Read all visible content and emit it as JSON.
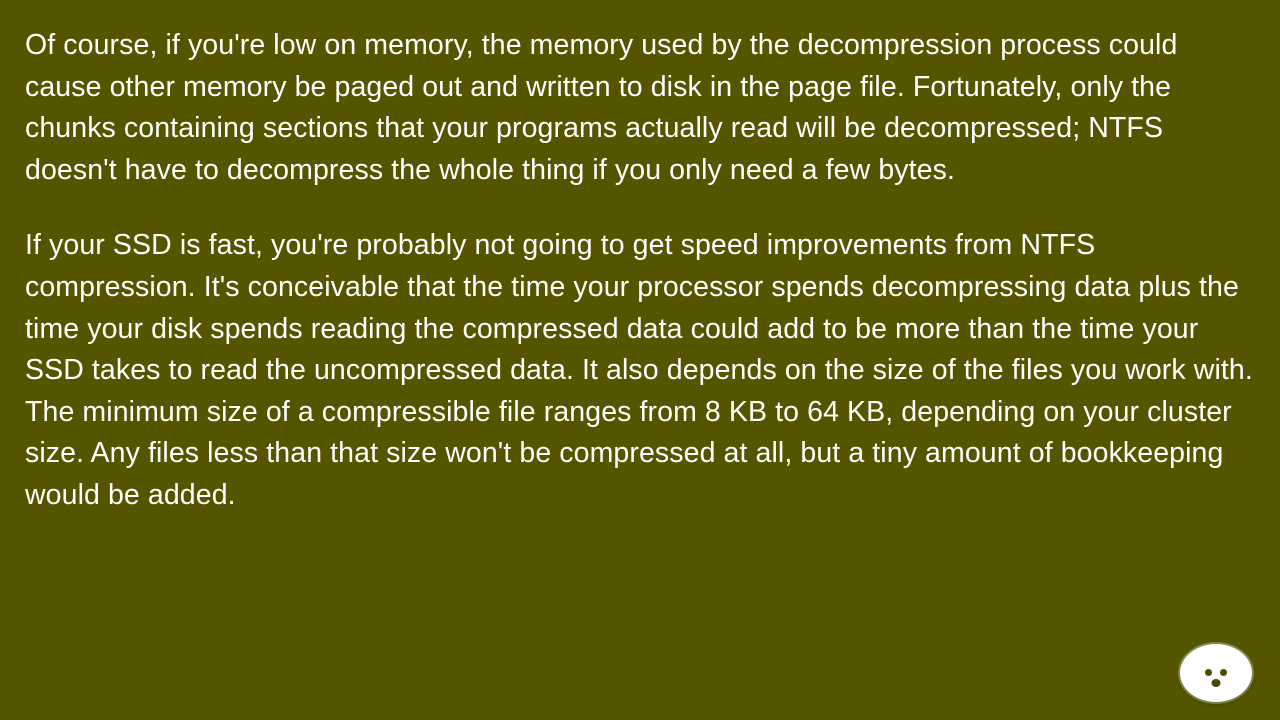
{
  "content": {
    "paragraphs": [
      "Of course, if you're low on memory, the memory used by the decompression process could cause other memory be paged out and written to disk in the page file. Fortunately, only the chunks containing sections that your programs actually read will be decompressed; NTFS doesn't have to decompress the whole thing if you only need a few bytes.",
      "If your SSD is fast, you're probably not going to get speed improvements from NTFS compression. It's conceivable that the time your processor spends decompressing data plus the time your disk spends reading the compressed data could add to be more than the time your SSD takes to read the uncompressed data. It also depends on the size of the files you work with. The minimum size of a compressible file ranges from 8 KB to 64 KB, depending on your cluster size. Any files less than that size won't be compressed at all, but a tiny amount of bookkeeping would be added."
    ]
  },
  "colors": {
    "background": "#555500",
    "text": "#ffffff"
  }
}
